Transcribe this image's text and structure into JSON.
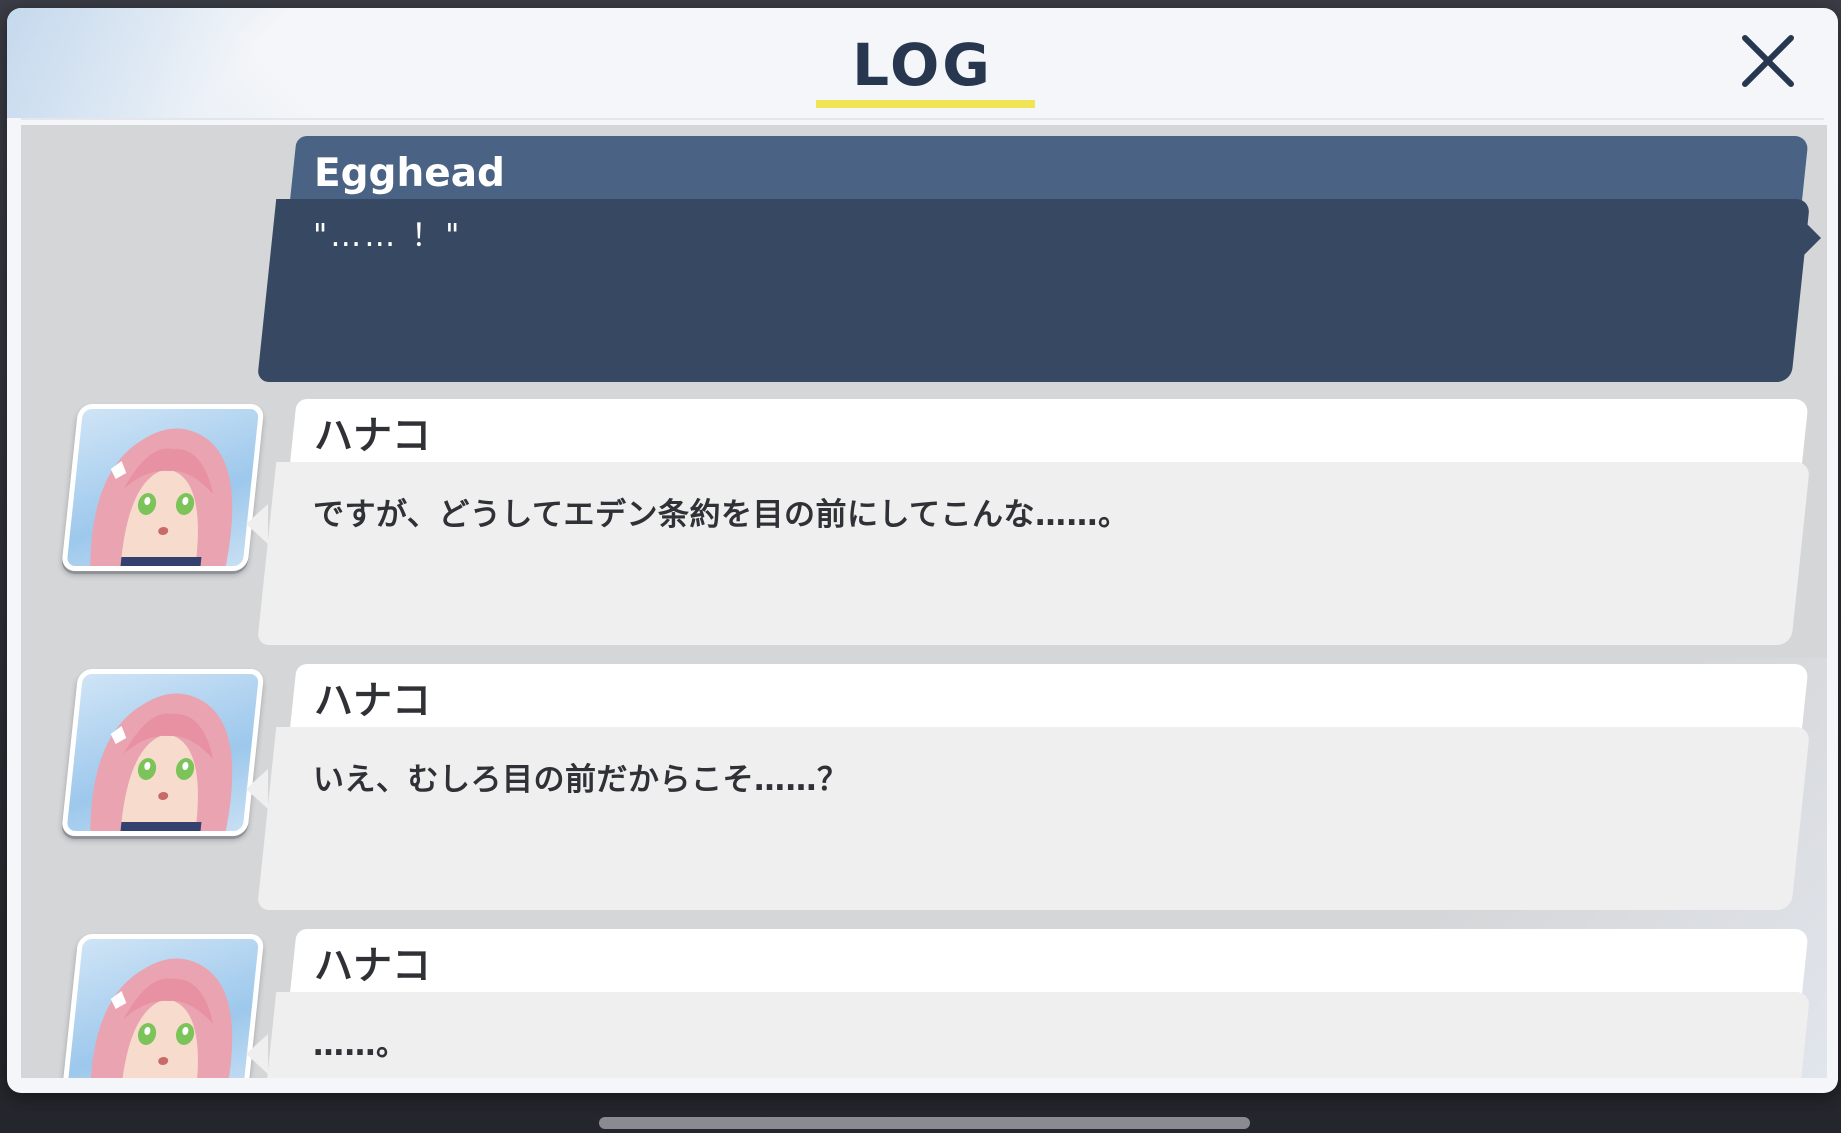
{
  "header": {
    "title": "LOG",
    "close_icon": "close-icon"
  },
  "log": {
    "entries": [
      {
        "speaker": "Egghead",
        "text": "\"…… ！\"",
        "kind": "player",
        "avatar": null
      },
      {
        "speaker": "ハナコ",
        "text": "ですが、どうしてエデン条約を目の前にしてこんな……。",
        "kind": "npc",
        "avatar": "hanako-portrait"
      },
      {
        "speaker": "ハナコ",
        "text": "いえ、むしろ目の前だからこそ……？",
        "kind": "npc",
        "avatar": "hanako-portrait"
      },
      {
        "speaker": "ハナコ",
        "text": "……。",
        "kind": "npc",
        "avatar": "hanako-portrait"
      }
    ]
  },
  "colors": {
    "accent_underline": "#f1e454",
    "title_text": "#27374f",
    "player_name_bar": "#4a6283",
    "player_bubble": "#374862",
    "npc_bubble": "#efefef"
  }
}
